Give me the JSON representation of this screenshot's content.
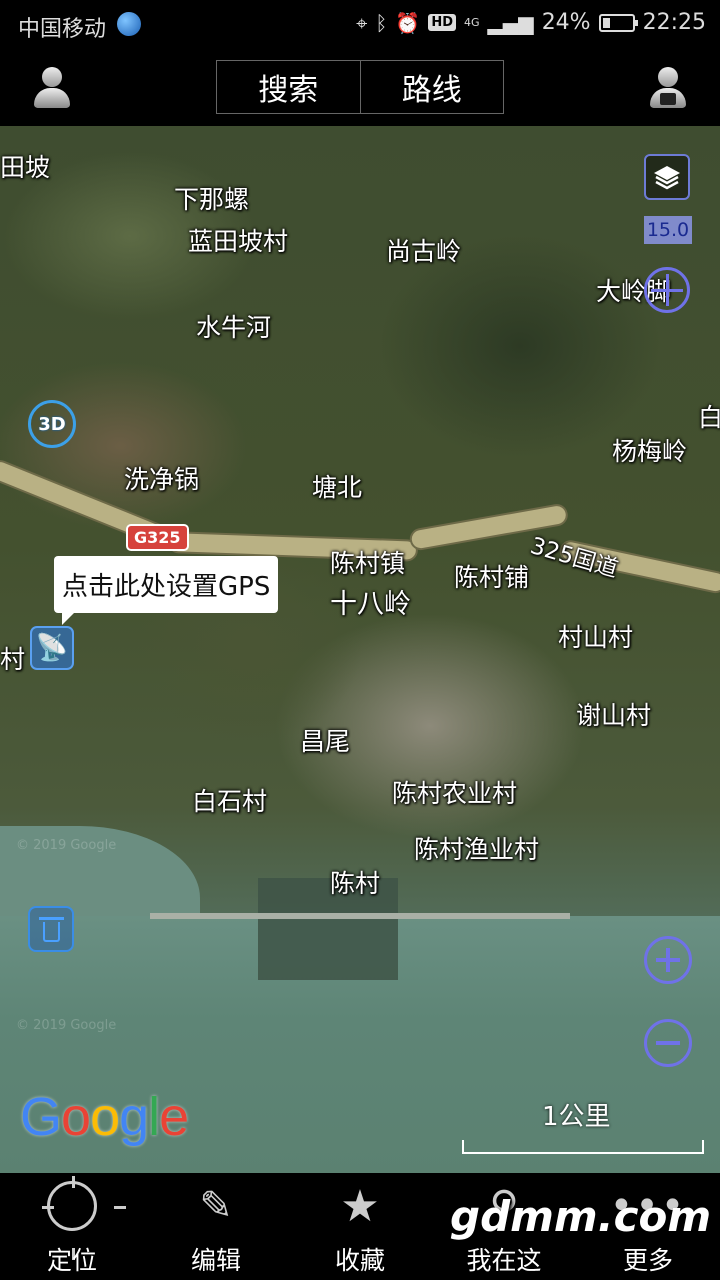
{
  "status_bar": {
    "carrier": "中国移动",
    "network": "4G",
    "hd": "HD",
    "battery_percent": "24%",
    "battery_level": 0.24,
    "time": "22:25"
  },
  "header": {
    "tabs": [
      {
        "label": "搜索"
      },
      {
        "label": "路线"
      }
    ]
  },
  "map": {
    "zoom_level": "15.0",
    "btn_3d": "3D",
    "gps_tooltip": "点击此处设置GPS",
    "road_shield": "G325",
    "google_logo": "Google",
    "scale_label": "1公里",
    "watermark": "© 2019 Google",
    "places": [
      {
        "name": "田坡"
      },
      {
        "name": "下那螺"
      },
      {
        "name": "蓝田坡村"
      },
      {
        "name": "尚古岭"
      },
      {
        "name": "大岭脚"
      },
      {
        "name": "水牛河"
      },
      {
        "name": "白"
      },
      {
        "name": "杨梅岭"
      },
      {
        "name": "洗净锅"
      },
      {
        "name": "塘北"
      },
      {
        "name": "325国道"
      },
      {
        "name": "陈村镇"
      },
      {
        "name": "陈村铺"
      },
      {
        "name": "十八岭"
      },
      {
        "name": "村山村"
      },
      {
        "name": "村"
      },
      {
        "name": "谢山村"
      },
      {
        "name": "昌尾"
      },
      {
        "name": "白石村"
      },
      {
        "name": "陈村农业村"
      },
      {
        "name": "陈村渔业村"
      },
      {
        "name": "陈村"
      }
    ],
    "google_colors": [
      "#4285F4",
      "#EA4335",
      "#FBBC05",
      "#4285F4",
      "#34A853",
      "#EA4335"
    ]
  },
  "bottom_nav": {
    "items": [
      {
        "label": "定位",
        "icon": "crosshair-icon"
      },
      {
        "label": "编辑",
        "icon": "pencil-icon"
      },
      {
        "label": "收藏",
        "icon": "star-icon"
      },
      {
        "label": "我在这",
        "icon": "pin-icon"
      },
      {
        "label": "更多",
        "icon": "more-icon"
      }
    ]
  },
  "site_watermark": "gdmm.com"
}
